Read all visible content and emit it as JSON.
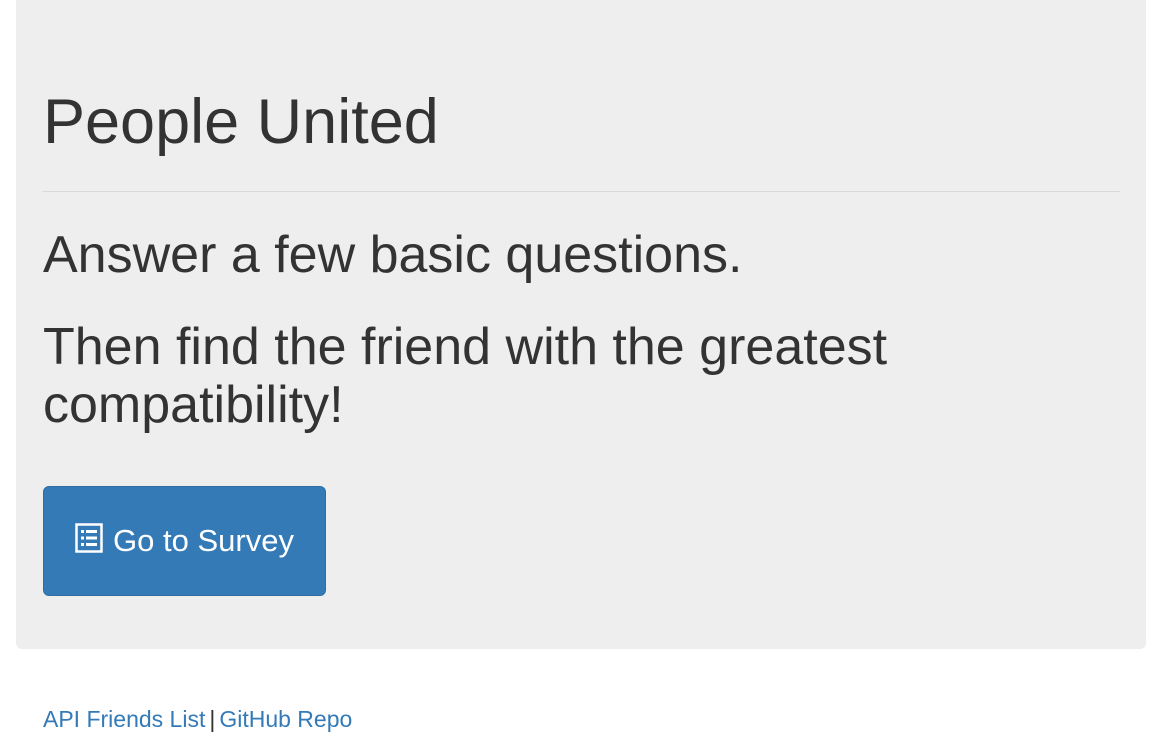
{
  "hero": {
    "title": "People United",
    "lead_1": "Answer a few basic questions.",
    "lead_2": "Then find the friend with the greatest compatibility!",
    "button_label": "Go to Survey",
    "button_icon": "list-alt-icon"
  },
  "footer": {
    "link_api": "API Friends List",
    "separator": "|",
    "link_github": "GitHub Repo"
  },
  "colors": {
    "hero_background": "#eeeeee",
    "primary": "#337ab7",
    "text": "#333333"
  }
}
